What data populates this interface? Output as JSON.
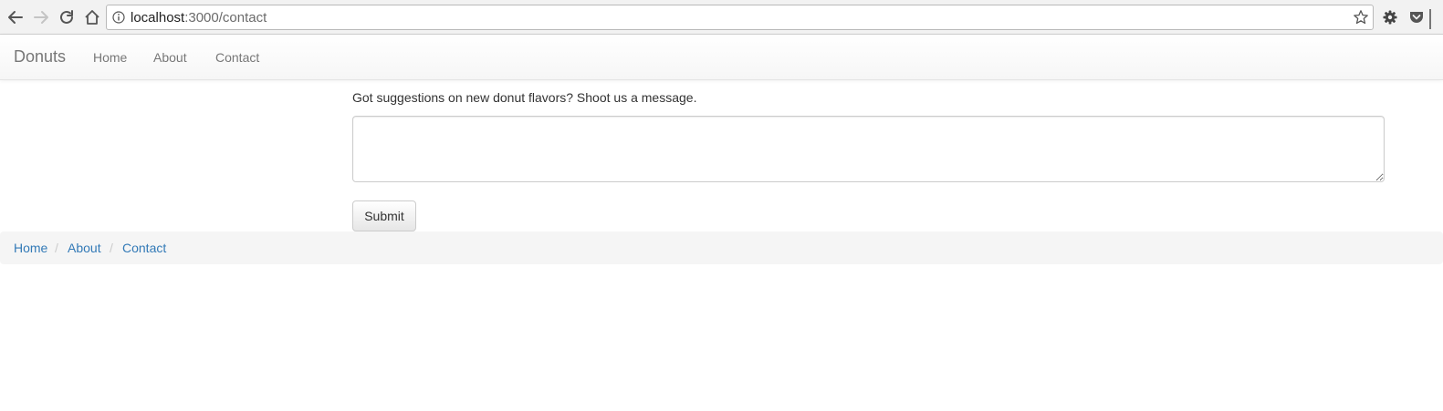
{
  "browser": {
    "url_host": "localhost",
    "url_path": ":3000/contact",
    "icons": {
      "back": "arrow-left-icon",
      "forward": "arrow-right-icon",
      "reload": "reload-icon",
      "home": "home-icon",
      "info": "info-icon",
      "bookmark": "star-icon",
      "extension": "gear-icon",
      "pocket": "pocket-icon"
    }
  },
  "navbar": {
    "brand": "Donuts",
    "links": [
      "Home",
      "About",
      "Contact"
    ]
  },
  "contact_form": {
    "intro": "Got suggestions on new donut flavors? Shoot us a message.",
    "message_value": "",
    "submit_label": "Submit"
  },
  "breadcrumb": {
    "items": [
      "Home",
      "About",
      "Contact"
    ],
    "separator": "/"
  },
  "colors": {
    "link": "#337ab7",
    "navbar_text": "#777777",
    "breadcrumb_bg": "#f5f5f5"
  }
}
